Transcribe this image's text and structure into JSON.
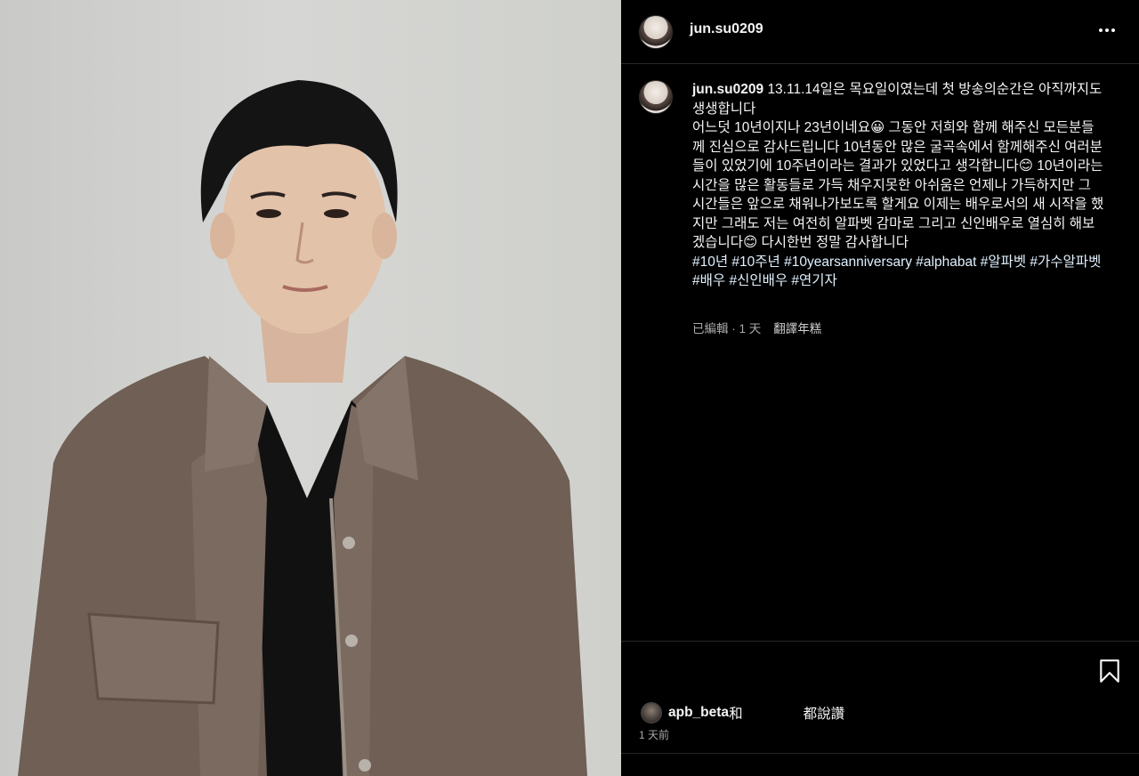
{
  "post": {
    "username": "jun.su0209",
    "caption_lines": [
      "13.11.14일은 목요일이였는데 첫 방송의순간은 아직까지도 생생합니다",
      "어느덧 10년이지나 23년이네요😀 그동안 저희와 함께 해주신 모든분들께 진심으로 감사드립니다 10년동안 많은 굴곡속에서 함께해주신 여러분들이 있었기에 10주년이라는 결과가 있었다고 생각합니다😊 10년이라는 시간을 많은 활동들로 가득 채우지못한 아쉬움은 언제나 가득하지만 그 시간들은 앞으로 채워나가보도록 할게요 이제는 배우로서의 새 시작을 했지만 그래도 저는 여전히 알파벳 감마로 그리고 신인배우로 열심히 해보겠습니다😊 다시한번 정말 감사합니다",
      "#10년 #10주년 #10yearsanniversary #alphabat #알파벳 #가수알파벳 #배우 #신인배우 #연기자"
    ],
    "edited_label": "已編輯",
    "age": "1 天",
    "translate_label": "翻譯年糕",
    "likes": {
      "liker": "apb_beta",
      "connector": "和",
      "suffix": "都說讚"
    },
    "post_time": "1 天前"
  },
  "icons": {
    "more": "more-horizontal-icon",
    "save": "bookmark-icon"
  },
  "colors": {
    "background": "#000000",
    "text": "#f5f5f5",
    "secondary_text": "#a8a8a8",
    "divider": "#262626"
  }
}
